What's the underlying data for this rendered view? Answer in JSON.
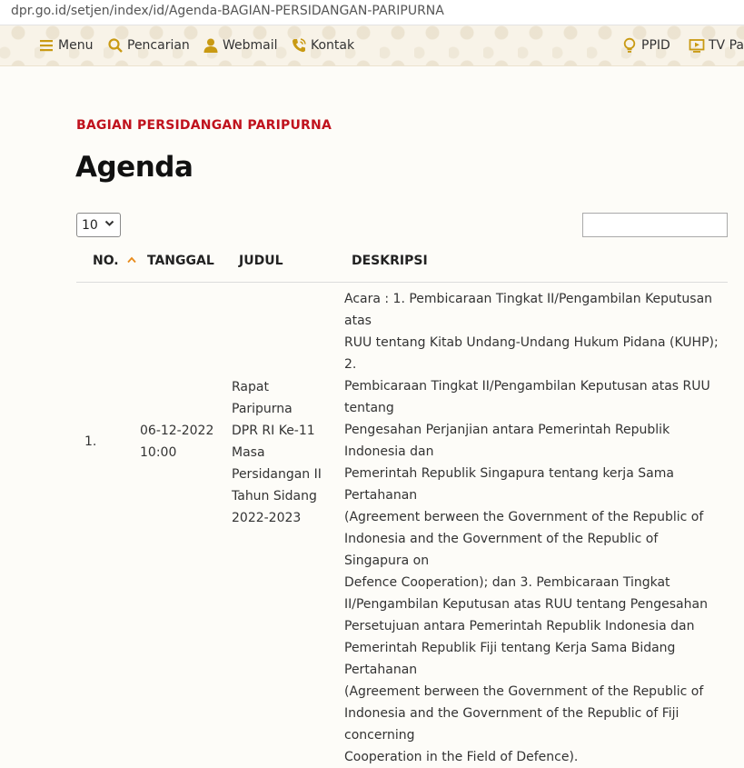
{
  "browser": {
    "url": "dpr.go.id/setjen/index/id/Agenda-BAGIAN-PERSIDANGAN-PARIPURNA"
  },
  "nav": {
    "items": [
      {
        "label": "Menu",
        "icon": "hamburger-icon"
      },
      {
        "label": "Pencarian",
        "icon": "search-icon"
      },
      {
        "label": "Webmail",
        "icon": "user-icon"
      },
      {
        "label": "Kontak",
        "icon": "phone-icon"
      },
      {
        "label": "PPID",
        "icon": "lightbulb-icon"
      },
      {
        "label": "TV Pa",
        "icon": "tv-icon"
      }
    ],
    "accent_color": "#c99a13"
  },
  "page": {
    "section_label": "BAGIAN PERSIDANGAN PARIPURNA",
    "title": "Agenda",
    "section_color": "#c0121d"
  },
  "controls": {
    "page_size": "10",
    "search_value": ""
  },
  "table": {
    "headers": [
      "NO.",
      "TANGGAL",
      "JUDUL",
      "DESKRIPSI"
    ],
    "sorted_column": "NO.",
    "rows": [
      {
        "no": "1.",
        "tanggal_lines": [
          "06-12-2022",
          "10:00"
        ],
        "judul_lines": [
          "Rapat Paripurna",
          "DPR RI Ke-11",
          "Masa",
          "Persidangan II",
          "Tahun Sidang",
          "2022-2023"
        ],
        "deskripsi_lines": [
          "Acara : 1. Pembicaraan Tingkat II/Pengambilan Keputusan atas",
          "RUU tentang Kitab Undang-Undang Hukum Pidana (KUHP); 2.",
          "Pembicaraan Tingkat II/Pengambilan Keputusan atas RUU tentang",
          "Pengesahan Perjanjian antara Pemerintah Republik Indonesia dan",
          "Pemerintah Republik Singapura tentang kerja Sama Pertahanan",
          "(Agreement berween the Government of the Republic of",
          "Indonesia and the Government of the Republic of Singapura on",
          "Defence Cooperation); dan 3. Pembicaraan Tingkat",
          "II/Pengambilan Keputusan atas RUU tentang Pengesahan",
          "Persetujuan antara Pemerintah Republik Indonesia dan",
          "Pemerintah Republik Fiji tentang Kerja Sama Bidang Pertahanan",
          "(Agreement berween the Government of the Republic of",
          "Indonesia and the Government of the Republic of Fiji concerning",
          "Cooperation in the Field of Defence)."
        ]
      }
    ]
  }
}
